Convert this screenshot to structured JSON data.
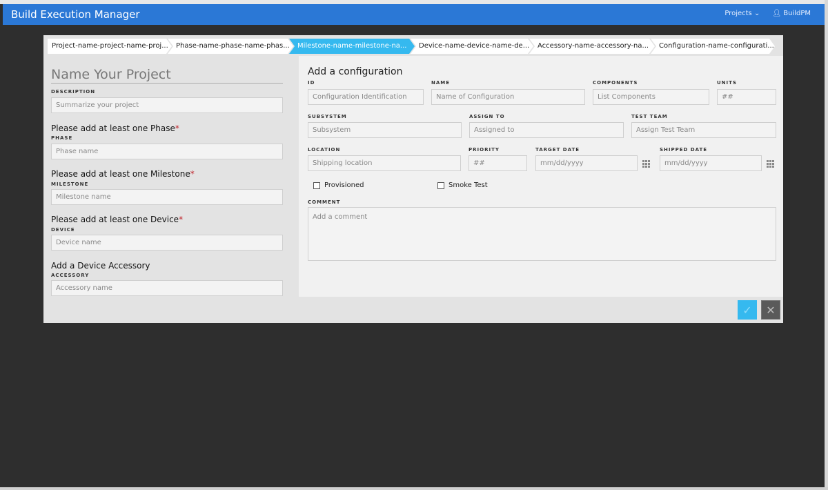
{
  "header": {
    "title": "Build Execution Manager",
    "projects": "Projects",
    "user": "BuildPM"
  },
  "breadcrumbs": [
    {
      "label": "Project-name-project-name-proj...",
      "active": false
    },
    {
      "label": "Phase-name-phase-name-phas...",
      "active": false
    },
    {
      "label": "Milestone-name-milestone-na...",
      "active": true
    },
    {
      "label": "Device-name-device-name-de...",
      "active": false
    },
    {
      "label": "Accessory-name-accessory-na...",
      "active": false
    },
    {
      "label": "Configuration-name-configurati...",
      "active": false
    }
  ],
  "left": {
    "project_title": "Name Your Project",
    "description_label": "DESCRIPTION",
    "description_placeholder": "Summarize your project",
    "phase_heading": "Please add at least one Phase",
    "phase_label": "PHASE",
    "phase_placeholder": "Phase name",
    "milestone_heading": "Please add at least one Milestone",
    "milestone_label": "MILESTONE",
    "milestone_placeholder": "Milestone name",
    "device_heading": "Please add at least one Device",
    "device_label": "DEVICE",
    "device_placeholder": "Device name",
    "accessory_heading": "Add a Device Accessory",
    "accessory_label": "ACCESSORY",
    "accessory_placeholder": "Accessory name",
    "required_mark": "*"
  },
  "config": {
    "heading": "Add a configuration",
    "id_label": "ID",
    "id_placeholder": "Configuration Identification",
    "name_label": "NAME",
    "name_placeholder": "Name of Configuration",
    "components_label": "COMPONENTS",
    "components_placeholder": "List Components",
    "units_label": "UNITS",
    "units_placeholder": "##",
    "subsystem_label": "SUBSYSTEM",
    "subsystem_placeholder": "Subsystem",
    "assign_label": "ASSIGN TO",
    "assign_placeholder": "Assigned to",
    "team_label": "TEST TEAM",
    "team_placeholder": "Assign Test Team",
    "location_label": "LOCATION",
    "location_placeholder": "Shipping location",
    "priority_label": "PRIORITY",
    "priority_placeholder": "##",
    "target_label": "TARGET DATE",
    "target_placeholder": "mm/dd/yyyy",
    "shipped_label": "SHIPPED DATE",
    "shipped_placeholder": "mm/dd/yyyy",
    "provisioned": "Provisioned",
    "smoke": "Smoke Test",
    "comment_label": "COMMENT",
    "comment_placeholder": "Add a comment"
  },
  "footer": {
    "confirm": "✓",
    "cancel": "✕"
  },
  "colors": {
    "header": "#2b78d6",
    "active_crumb": "#35b9ef",
    "confirm": "#35b9ef",
    "cancel": "#5a5a5a"
  }
}
